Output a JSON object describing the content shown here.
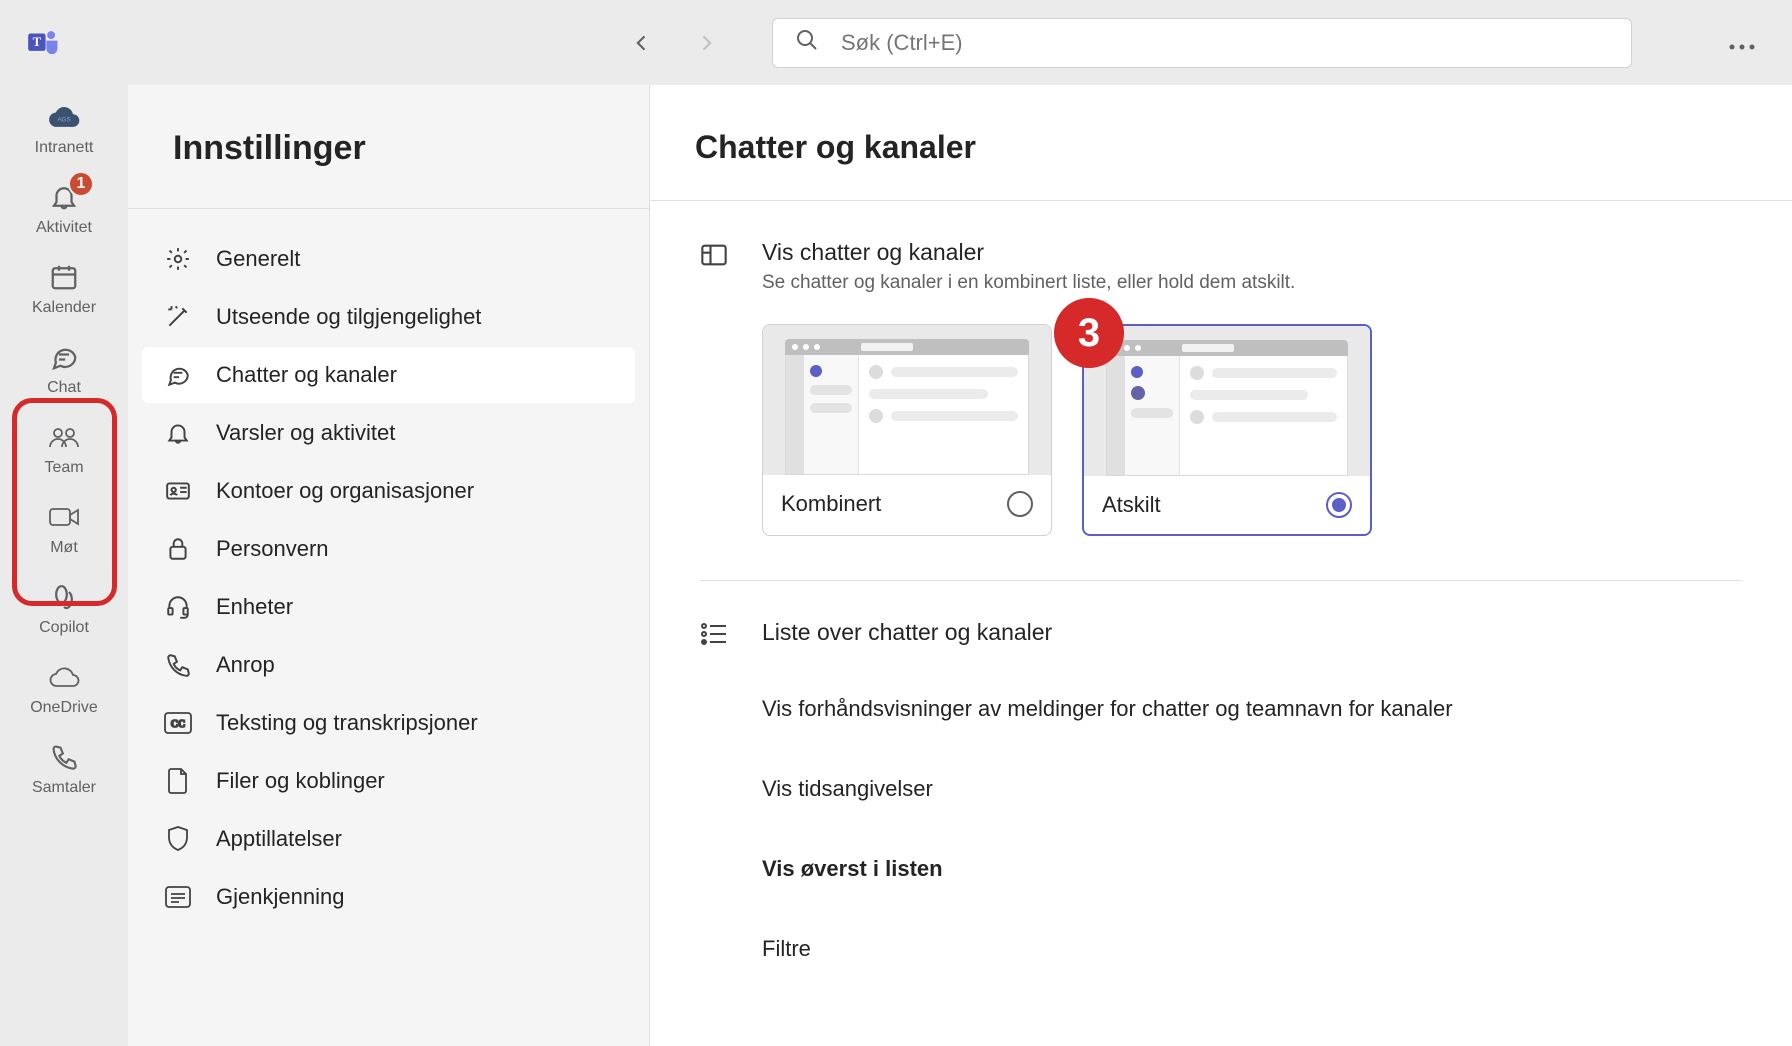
{
  "search": {
    "placeholder": "Søk (Ctrl+E)"
  },
  "rail": {
    "items": [
      {
        "label": "Intranett"
      },
      {
        "label": "Aktivitet",
        "badge": "1"
      },
      {
        "label": "Kalender"
      },
      {
        "label": "Chat"
      },
      {
        "label": "Team"
      },
      {
        "label": "Møt"
      },
      {
        "label": "Copilot"
      },
      {
        "label": "OneDrive"
      },
      {
        "label": "Samtaler"
      }
    ]
  },
  "settings": {
    "title": "Innstillinger",
    "items": [
      {
        "label": "Generelt"
      },
      {
        "label": "Utseende og tilgjengelighet"
      },
      {
        "label": "Chatter og kanaler"
      },
      {
        "label": "Varsler og aktivitet"
      },
      {
        "label": "Kontoer og organisasjoner"
      },
      {
        "label": "Personvern"
      },
      {
        "label": "Enheter"
      },
      {
        "label": "Anrop"
      },
      {
        "label": "Teksting og transkripsjoner"
      },
      {
        "label": "Filer og koblinger"
      },
      {
        "label": "Apptillatelser"
      },
      {
        "label": "Gjenkjenning"
      }
    ]
  },
  "content": {
    "title": "Chatter og kanaler",
    "view_heading": "Vis chatter og kanaler",
    "view_sub": "Se chatter og kanaler i en kombinert liste, eller hold dem atskilt.",
    "option_combined": "Kombinert",
    "option_separate": "Atskilt",
    "list_heading": "Liste over chatter og kanaler",
    "opt_previews": "Vis forhåndsvisninger av meldinger for chatter og teamnavn for kanaler",
    "opt_times": "Vis tidsangivelser",
    "opt_top": "Vis øverst i listen",
    "opt_filters": "Filtre"
  },
  "annotation": {
    "number": "3"
  }
}
